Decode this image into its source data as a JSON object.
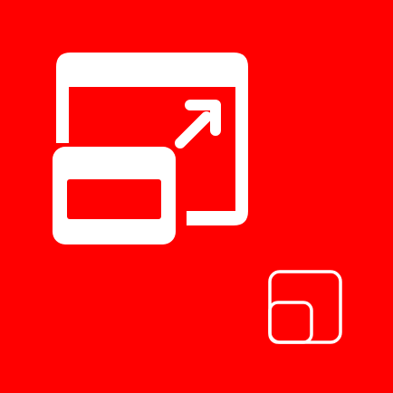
{
  "background_color": "#ff0000",
  "icon_color": "#ffffff",
  "icons": {
    "main": "expand-window-icon",
    "secondary": "picture-in-picture-icon"
  }
}
